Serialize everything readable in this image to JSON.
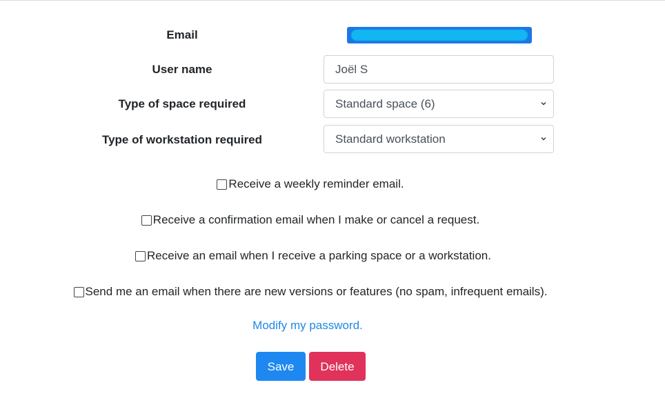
{
  "form": {
    "email_label": "Email",
    "username_label": "User name",
    "username_value": "Joël S",
    "space_label": "Type of space required",
    "space_value": "Standard space (6)",
    "workstation_label": "Type of workstation required",
    "workstation_value": "Standard workstation"
  },
  "checkboxes": [
    {
      "label": "Receive a weekly reminder email.",
      "checked": false
    },
    {
      "label": "Receive a confirmation email when I make or cancel a request.",
      "checked": false
    },
    {
      "label": "Receive an email when I receive a parking space or a workstation.",
      "checked": false
    },
    {
      "label": "Send me an email when there are new versions or features (no spam, infrequent emails).",
      "checked": false
    }
  ],
  "links": {
    "modify_password": "Modify my password."
  },
  "buttons": {
    "save_label": "Save",
    "delete_label": "Delete"
  },
  "colors": {
    "primary": "#1e88f0",
    "danger": "#e0325a",
    "link": "#1e88e5"
  }
}
